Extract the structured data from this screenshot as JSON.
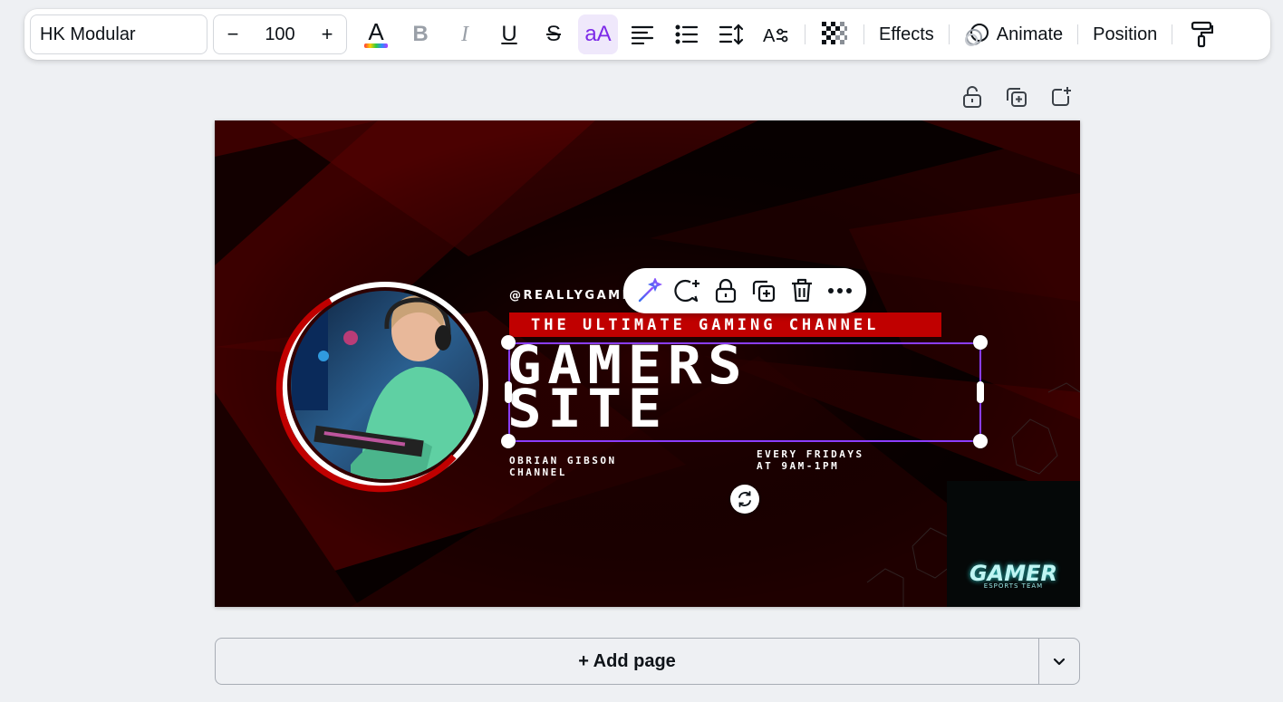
{
  "toolbar": {
    "font_name": "HK Modular",
    "size_decrease": "−",
    "font_size": "100",
    "size_increase": "+",
    "bold_label": "B",
    "italic_label": "I",
    "underline_label": "U",
    "strike_label": "S",
    "case_label": "aA",
    "effects_label": "Effects",
    "animate_label": "Animate",
    "position_label": "Position"
  },
  "design": {
    "handle": "@REALLYGAMER",
    "banner": "THE ULTIMATE GAMING CHANNEL",
    "headline_line1": "GAMERS",
    "headline_line2": "SITE",
    "sub_left_line1": "OBRIAN GIBSON",
    "sub_left_line2": "CHANNEL",
    "sub_right_line1": "EVERY FRIDAYS",
    "sub_right_line2": "AT 9AM-1PM",
    "logo_word": "GAMER",
    "logo_sub": "ESPORTS TEAM"
  },
  "add_page": {
    "label": "+ Add page"
  },
  "colors": {
    "accent": "#8b3dff",
    "banner_red": "#c00000",
    "logo_cyan": "#29c6c4"
  }
}
